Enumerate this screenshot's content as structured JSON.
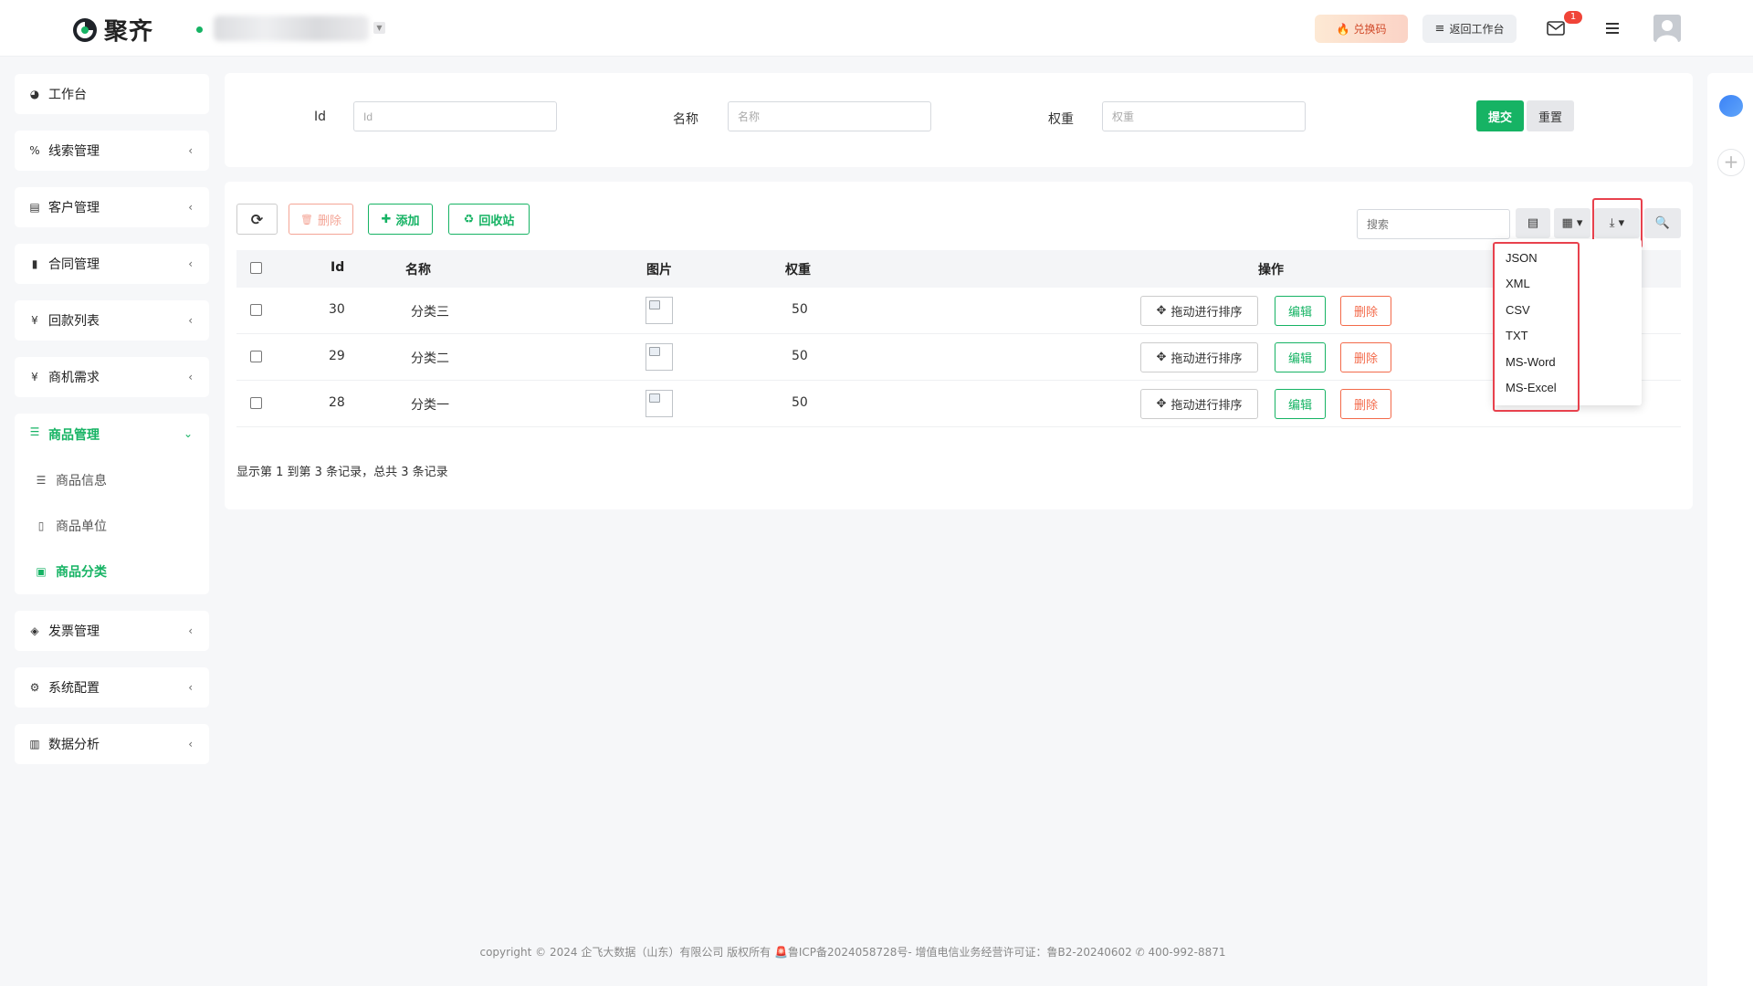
{
  "brand": {
    "name": "聚齐"
  },
  "header": {
    "redeem_label": "兑换码",
    "back_label": "返回工作台",
    "mail_badge": "1"
  },
  "sidebar": {
    "items": [
      {
        "label": "工作台",
        "icon": "dashboard-icon"
      },
      {
        "label": "线索管理",
        "icon": "link-icon"
      },
      {
        "label": "客户管理",
        "icon": "id-card-icon"
      },
      {
        "label": "合同管理",
        "icon": "bookmark-icon"
      },
      {
        "label": "回款列表",
        "icon": "yen-icon"
      },
      {
        "label": "商机需求",
        "icon": "yen-icon"
      },
      {
        "label": "商品管理",
        "icon": "list-icon"
      },
      {
        "label": "发票管理",
        "icon": "tag-icon"
      },
      {
        "label": "系统配置",
        "icon": "gears-icon"
      },
      {
        "label": "数据分析",
        "icon": "bar-chart-icon"
      }
    ],
    "sub_items": [
      {
        "label": "商品信息",
        "icon": "indent-icon"
      },
      {
        "label": "商品单位",
        "icon": "file-icon"
      },
      {
        "label": "商品分类",
        "icon": "calendar-plus-icon"
      }
    ]
  },
  "filter": {
    "id_label": "Id",
    "id_placeholder": "Id",
    "name_label": "名称",
    "name_placeholder": "名称",
    "weight_label": "权重",
    "weight_placeholder": "权重",
    "submit_label": "提交",
    "reset_label": "重置"
  },
  "toolbar": {
    "delete_label": "删除",
    "add_label": "添加",
    "recycle_label": "回收站",
    "search_placeholder": "搜索"
  },
  "table": {
    "columns": [
      "Id",
      "名称",
      "图片",
      "权重",
      "操作"
    ],
    "rows": [
      {
        "id": "30",
        "name": "分类三",
        "weight": "50"
      },
      {
        "id": "29",
        "name": "分类二",
        "weight": "50"
      },
      {
        "id": "28",
        "name": "分类一",
        "weight": "50"
      }
    ],
    "drag_label": "拖动进行排序",
    "edit_label": "编辑",
    "delete_label": "删除",
    "summary": "显示第 1 到第 3 条记录，总共 3 条记录"
  },
  "export_menu": [
    "JSON",
    "XML",
    "CSV",
    "TXT",
    "MS-Word",
    "MS-Excel"
  ],
  "footer": {
    "text": "copyright © 2024 企飞大数据（山东）有限公司 版权所有 🚨鲁ICP备2024058728号-  增值电信业务经营许可证：鲁B2-20240602 ✆ 400-992-8871"
  },
  "colors": {
    "accent": "#16b364",
    "danger": "#f36a4a",
    "highlight": "#e8414d"
  }
}
